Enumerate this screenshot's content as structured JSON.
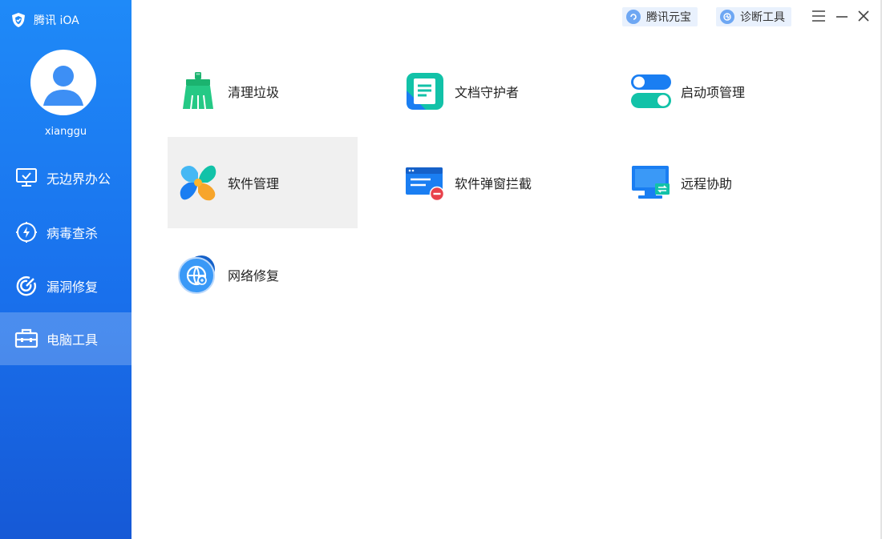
{
  "app": {
    "brand_name": "腾讯 iOA",
    "username": "xianggu"
  },
  "sidebar": {
    "items": [
      {
        "label": "无边界办公",
        "icon": "monitor-check-icon",
        "active": false
      },
      {
        "label": "病毒查杀",
        "icon": "lightning-shield-icon",
        "active": false
      },
      {
        "label": "漏洞修复",
        "icon": "target-icon",
        "active": false
      },
      {
        "label": "电脑工具",
        "icon": "toolbox-icon",
        "active": true
      }
    ]
  },
  "topbar": {
    "yuanbao_label": "腾讯元宝",
    "diagnose_label": "诊断工具",
    "menu_icon": "hamburger-icon",
    "minimize_icon": "minimize-icon",
    "close_icon": "close-icon"
  },
  "tools": [
    {
      "label": "清理垃圾",
      "icon": "broom-icon"
    },
    {
      "label": "文档守护者",
      "icon": "document-guard-icon"
    },
    {
      "label": "启动项管理",
      "icon": "toggle-switch-icon"
    },
    {
      "label": "软件管理",
      "icon": "clover-apps-icon",
      "hovered": true
    },
    {
      "label": "软件弹窗拦截",
      "icon": "popup-block-icon"
    },
    {
      "label": "远程协助",
      "icon": "remote-monitor-icon"
    },
    {
      "label": "网络修复",
      "icon": "globe-repair-icon"
    }
  ],
  "colors": {
    "sidebar_top": "#1f8af8",
    "sidebar_bottom": "#1659d6",
    "hover_bg": "#f0f0f0"
  }
}
